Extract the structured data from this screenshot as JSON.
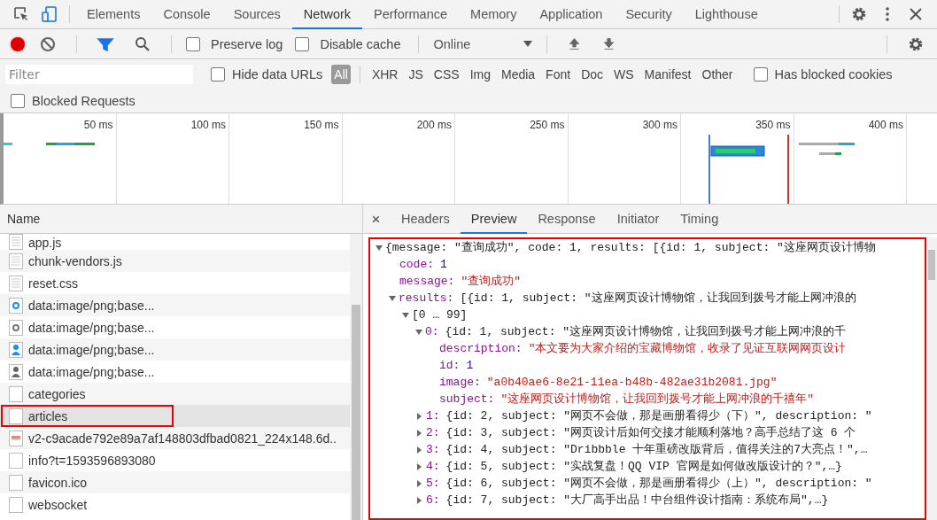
{
  "main_tabs": [
    {
      "label": "Elements",
      "selected": false
    },
    {
      "label": "Console",
      "selected": false
    },
    {
      "label": "Sources",
      "selected": false
    },
    {
      "label": "Network",
      "selected": true
    },
    {
      "label": "Performance",
      "selected": false
    },
    {
      "label": "Memory",
      "selected": false
    },
    {
      "label": "Application",
      "selected": false
    },
    {
      "label": "Security",
      "selected": false
    },
    {
      "label": "Lighthouse",
      "selected": false
    }
  ],
  "toolbar": {
    "recording": true,
    "filter_active": true,
    "preserve_log": {
      "label": "Preserve log",
      "checked": false
    },
    "disable_cache": {
      "label": "Disable cache",
      "checked": false
    },
    "throttling": "Online"
  },
  "filter_bar": {
    "placeholder": "Filter",
    "hide_data_urls": {
      "label": "Hide data URLs",
      "checked": false
    },
    "types": [
      {
        "label": "All",
        "selected": true
      },
      {
        "label": "XHR",
        "selected": false
      },
      {
        "label": "JS",
        "selected": false
      },
      {
        "label": "CSS",
        "selected": false
      },
      {
        "label": "Img",
        "selected": false
      },
      {
        "label": "Media",
        "selected": false
      },
      {
        "label": "Font",
        "selected": false
      },
      {
        "label": "Doc",
        "selected": false
      },
      {
        "label": "WS",
        "selected": false
      },
      {
        "label": "Manifest",
        "selected": false
      },
      {
        "label": "Other",
        "selected": false
      }
    ],
    "has_blocked_cookies": {
      "label": "Has blocked cookies",
      "checked": false
    },
    "blocked_requests": {
      "label": "Blocked Requests",
      "checked": false
    }
  },
  "timeline": {
    "ticks": [
      "50 ms",
      "100 ms",
      "150 ms",
      "200 ms",
      "250 ms",
      "300 ms",
      "350 ms",
      "400 ms"
    ]
  },
  "requests": {
    "column": "Name",
    "rows": [
      {
        "name": "app.js",
        "kind": "lines",
        "selected": false,
        "highlighted": false
      },
      {
        "name": "chunk-vendors.js",
        "kind": "lines",
        "selected": false,
        "highlighted": false
      },
      {
        "name": "reset.css",
        "kind": "lines",
        "selected": false,
        "highlighted": false
      },
      {
        "name": "data:image/png;base...",
        "kind": "circle-blue",
        "selected": false,
        "highlighted": false
      },
      {
        "name": "data:image/png;base...",
        "kind": "circle-gray",
        "selected": false,
        "highlighted": false
      },
      {
        "name": "data:image/png;base...",
        "kind": "person-blue",
        "selected": false,
        "highlighted": false
      },
      {
        "name": "data:image/png;base...",
        "kind": "person-gray",
        "selected": false,
        "highlighted": false
      },
      {
        "name": "categories",
        "kind": "blank",
        "selected": false,
        "highlighted": false
      },
      {
        "name": "articles",
        "kind": "blank",
        "selected": true,
        "highlighted": true
      },
      {
        "name": "v2-c9acade792e89a7af148803dfbad0821_224x148.6d..",
        "kind": "thumbnail",
        "selected": false,
        "highlighted": false
      },
      {
        "name": "info?t=1593596893080",
        "kind": "blank",
        "selected": false,
        "highlighted": false
      },
      {
        "name": "favicon.ico",
        "kind": "blank",
        "selected": false,
        "highlighted": false
      },
      {
        "name": "websocket",
        "kind": "blank",
        "selected": false,
        "highlighted": false
      }
    ]
  },
  "detail_tabs": [
    {
      "label": "Headers",
      "selected": false
    },
    {
      "label": "Preview",
      "selected": true
    },
    {
      "label": "Response",
      "selected": false
    },
    {
      "label": "Initiator",
      "selected": false
    },
    {
      "label": "Timing",
      "selected": false
    }
  ],
  "preview": {
    "highlighted": true,
    "tree": [
      {
        "summary": "{message: \"查询成功\", code: 1, results: [{id: 1, subject: \"这座网页设计博物",
        "expanded": true,
        "children": [
          {
            "key": "code:",
            "value": "1",
            "kind": "number"
          },
          {
            "key": "message:",
            "value": "\"查询成功\"",
            "kind": "string"
          },
          {
            "key": "results:",
            "summary": "[{id: 1, subject: \"这座网页设计博物馆，让我回到拨号才能上网冲浪的",
            "expanded": true,
            "children": [
              {
                "summary": "[0 … 99]",
                "expanded": true,
                "children": [
                  {
                    "key": "0:",
                    "summary": "{id: 1, subject: \"这座网页设计博物馆，让我回到拨号才能上网冲浪的千",
                    "expanded": true,
                    "children": [
                      {
                        "key": "description:",
                        "value": "\"本文要为大家介绍的宝藏博物馆，收录了见证互联网网页设计",
                        "kind": "string"
                      },
                      {
                        "key": "id:",
                        "value": "1",
                        "kind": "number"
                      },
                      {
                        "key": "image:",
                        "value": "\"a0b40ae6-8e21-11ea-b48b-482ae31b2081.jpg\"",
                        "kind": "string"
                      },
                      {
                        "key": "subject:",
                        "value": "\"这座网页设计博物馆，让我回到拨号才能上网冲浪的千禧年\"",
                        "kind": "string"
                      }
                    ]
                  },
                  {
                    "key": "1:",
                    "summary": "{id: 2, subject: \"网页不会做，那是画册看得少（下）\", description: \"",
                    "expanded": false
                  },
                  {
                    "key": "2:",
                    "summary": "{id: 3, subject: \"网页设计后如何交接才能顺利落地？高手总结了这 6 个",
                    "expanded": false
                  },
                  {
                    "key": "3:",
                    "summary": "{id: 4, subject: \"Dribbble 十年重磅改版背后，值得关注的7大亮点！\",…",
                    "expanded": false
                  },
                  {
                    "key": "4:",
                    "summary": "{id: 5, subject: \"实战复盘！QQ VIP 官网是如何做改版设计的？\",…}",
                    "expanded": false
                  },
                  {
                    "key": "5:",
                    "summary": "{id: 6, subject: \"网页不会做，那是画册看得少（上）\", description: \"",
                    "expanded": false
                  },
                  {
                    "key": "6:",
                    "summary": "{id: 7, subject: \"大厂高手出品！中台组件设计指南：系统布局\",…}",
                    "expanded": false
                  }
                ]
              }
            ]
          }
        ]
      }
    ]
  }
}
